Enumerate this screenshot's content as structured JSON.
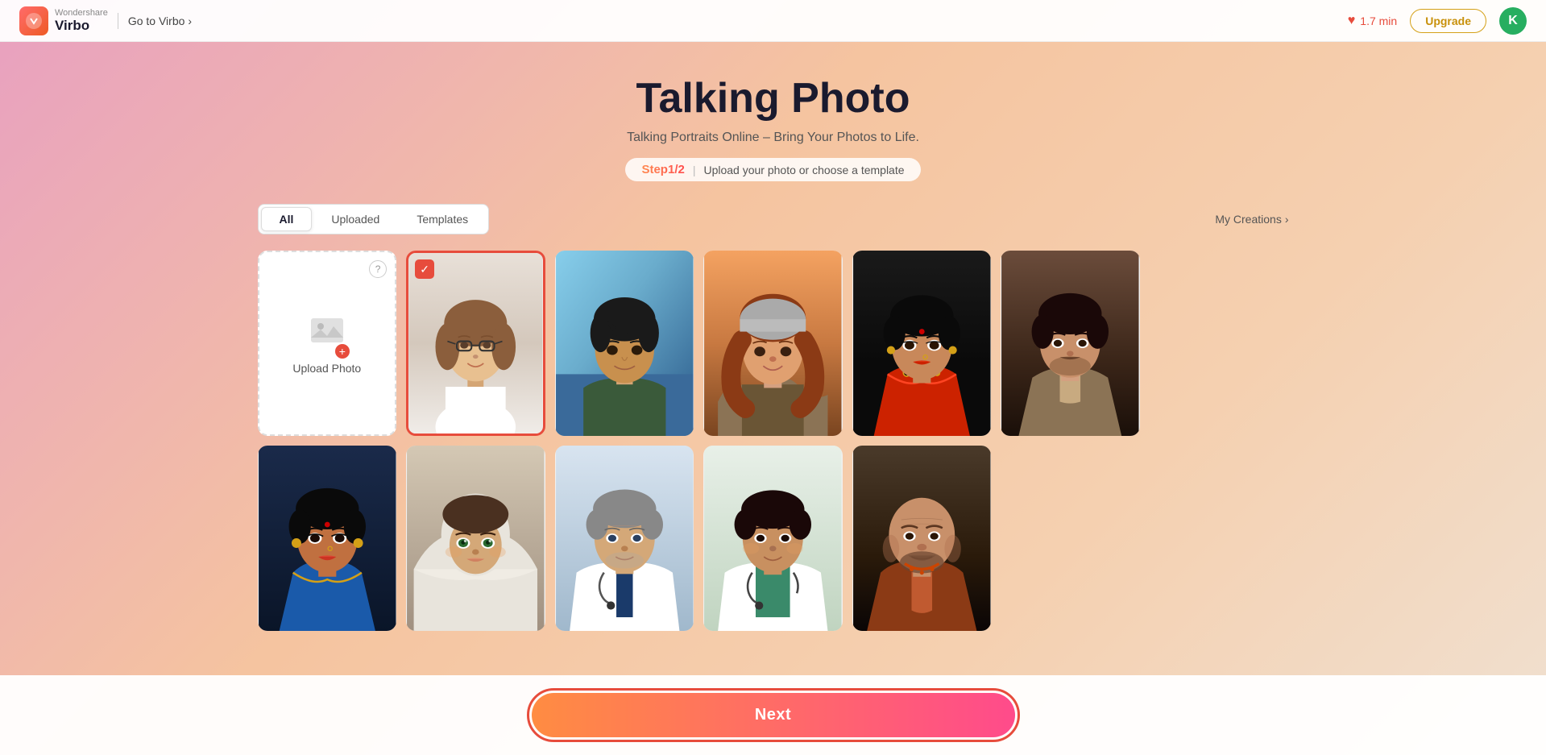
{
  "header": {
    "logo_brand": "Wondershare",
    "logo_product": "Virbo",
    "go_to_virbo": "Go to Virbo",
    "time": "1.7 min",
    "upgrade_label": "Upgrade",
    "avatar_initial": "K"
  },
  "hero": {
    "title": "Talking Photo",
    "subtitle": "Talking Portraits Online – Bring Your Photos to Life.",
    "step_label": "Step1/2",
    "step_separator": "|",
    "step_desc": "Upload your photo or choose a template"
  },
  "filters": {
    "tabs": [
      {
        "label": "All",
        "active": true
      },
      {
        "label": "Uploaded",
        "active": false
      },
      {
        "label": "Templates",
        "active": false
      }
    ],
    "my_creations": "My Creations"
  },
  "upload_card": {
    "label": "Upload Photo",
    "help": "?"
  },
  "next_button": {
    "label": "Next"
  },
  "portraits": [
    {
      "id": "selected-portrait",
      "selected": true
    },
    {
      "id": "portrait-young-male"
    },
    {
      "id": "portrait-girl-scarf"
    },
    {
      "id": "portrait-woman-red"
    },
    {
      "id": "portrait-man-vest"
    },
    {
      "id": "portrait-woman-blue"
    },
    {
      "id": "portrait-woman-wrap"
    },
    {
      "id": "portrait-woman-white"
    },
    {
      "id": "portrait-doctor-male"
    },
    {
      "id": "portrait-doctor-female"
    },
    {
      "id": "portrait-elder-man"
    }
  ]
}
